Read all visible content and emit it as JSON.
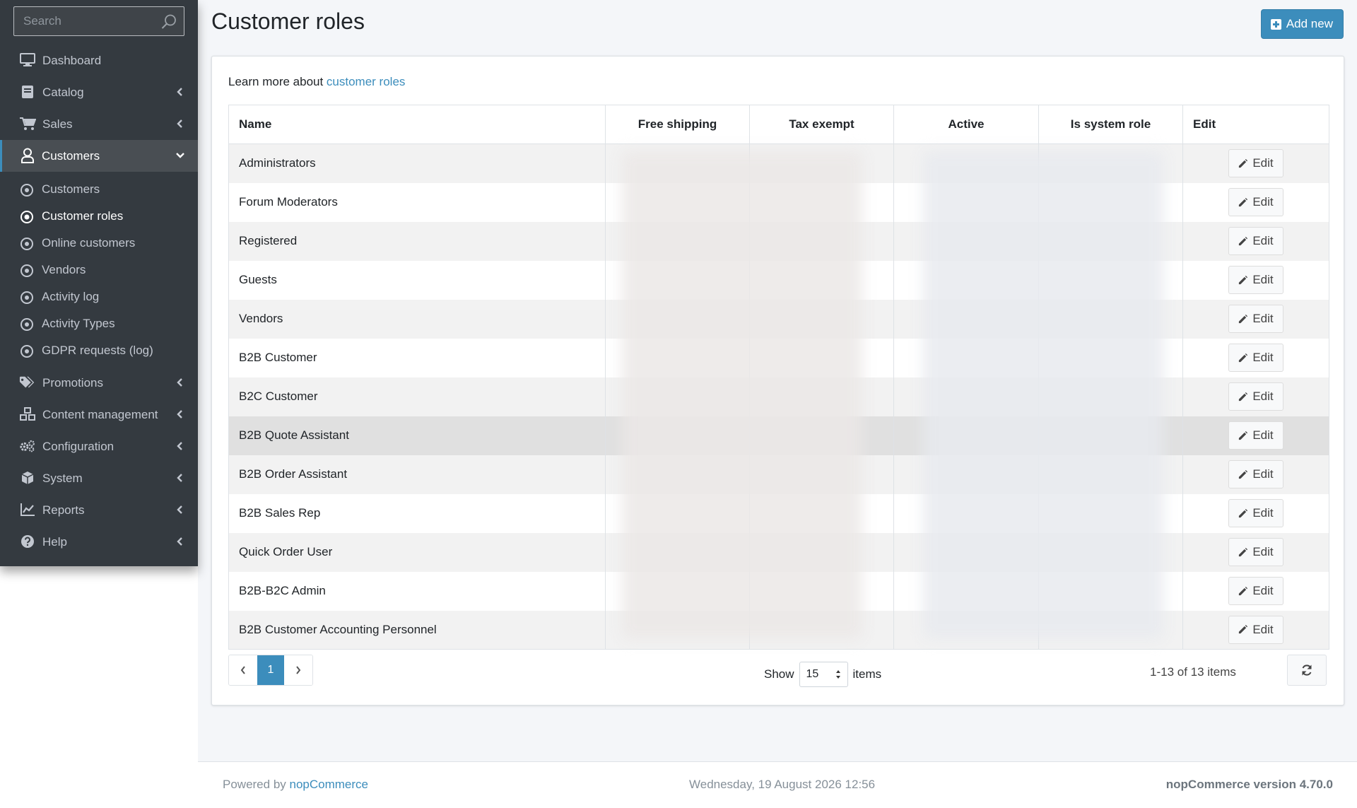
{
  "sidebar": {
    "search_placeholder": "Search",
    "nav": [
      {
        "label": "Dashboard",
        "icon": "monitor-icon",
        "chevron": false
      },
      {
        "label": "Catalog",
        "icon": "book-icon",
        "chevron": true
      },
      {
        "label": "Sales",
        "icon": "cart-icon",
        "chevron": true
      },
      {
        "label": "Customers",
        "icon": "user-icon",
        "chevron": true,
        "open": true
      },
      {
        "label": "Promotions",
        "icon": "tags-icon",
        "chevron": true
      },
      {
        "label": "Content management",
        "icon": "cubes-icon",
        "chevron": true
      },
      {
        "label": "Configuration",
        "icon": "gears-icon",
        "chevron": true
      },
      {
        "label": "System",
        "icon": "cube-icon",
        "chevron": true
      },
      {
        "label": "Reports",
        "icon": "chart-icon",
        "chevron": true
      },
      {
        "label": "Help",
        "icon": "question-icon",
        "chevron": true
      }
    ],
    "customers_sub": [
      {
        "label": "Customers"
      },
      {
        "label": "Customer roles",
        "active": true
      },
      {
        "label": "Online customers"
      },
      {
        "label": "Vendors"
      },
      {
        "label": "Activity log"
      },
      {
        "label": "Activity Types"
      },
      {
        "label": "GDPR requests (log)"
      }
    ]
  },
  "header": {
    "title": "Customer roles",
    "add_new_label": "Add new"
  },
  "intro": {
    "text": "Learn more about ",
    "link": "customer roles"
  },
  "table": {
    "columns": [
      "Name",
      "Free shipping",
      "Tax exempt",
      "Active",
      "Is system role",
      "Edit"
    ],
    "edit_label": "Edit",
    "rows": [
      "Administrators",
      "Forum Moderators",
      "Registered",
      "Guests",
      "Vendors",
      "B2B Customer",
      "B2C Customer",
      "B2B Quote Assistant",
      "B2B Order Assistant",
      "B2B Sales Rep",
      "Quick Order User",
      "B2B-B2C Admin",
      "B2B Customer Accounting Personnel"
    ]
  },
  "pager": {
    "current_page": "1",
    "show_label": "Show",
    "page_size": "15",
    "items_label": "items",
    "range_info": "1-13 of 13 items"
  },
  "footer": {
    "powered_text": "Powered by ",
    "powered_link": "nopCommerce",
    "datetime": "Wednesday, 19 August 2026 12:56",
    "version": "nopCommerce version 4.70.0"
  },
  "colors": {
    "sidebar_bg": "#343a40",
    "accent": "#3c8dbc",
    "page_bg": "#f4f6f9"
  }
}
